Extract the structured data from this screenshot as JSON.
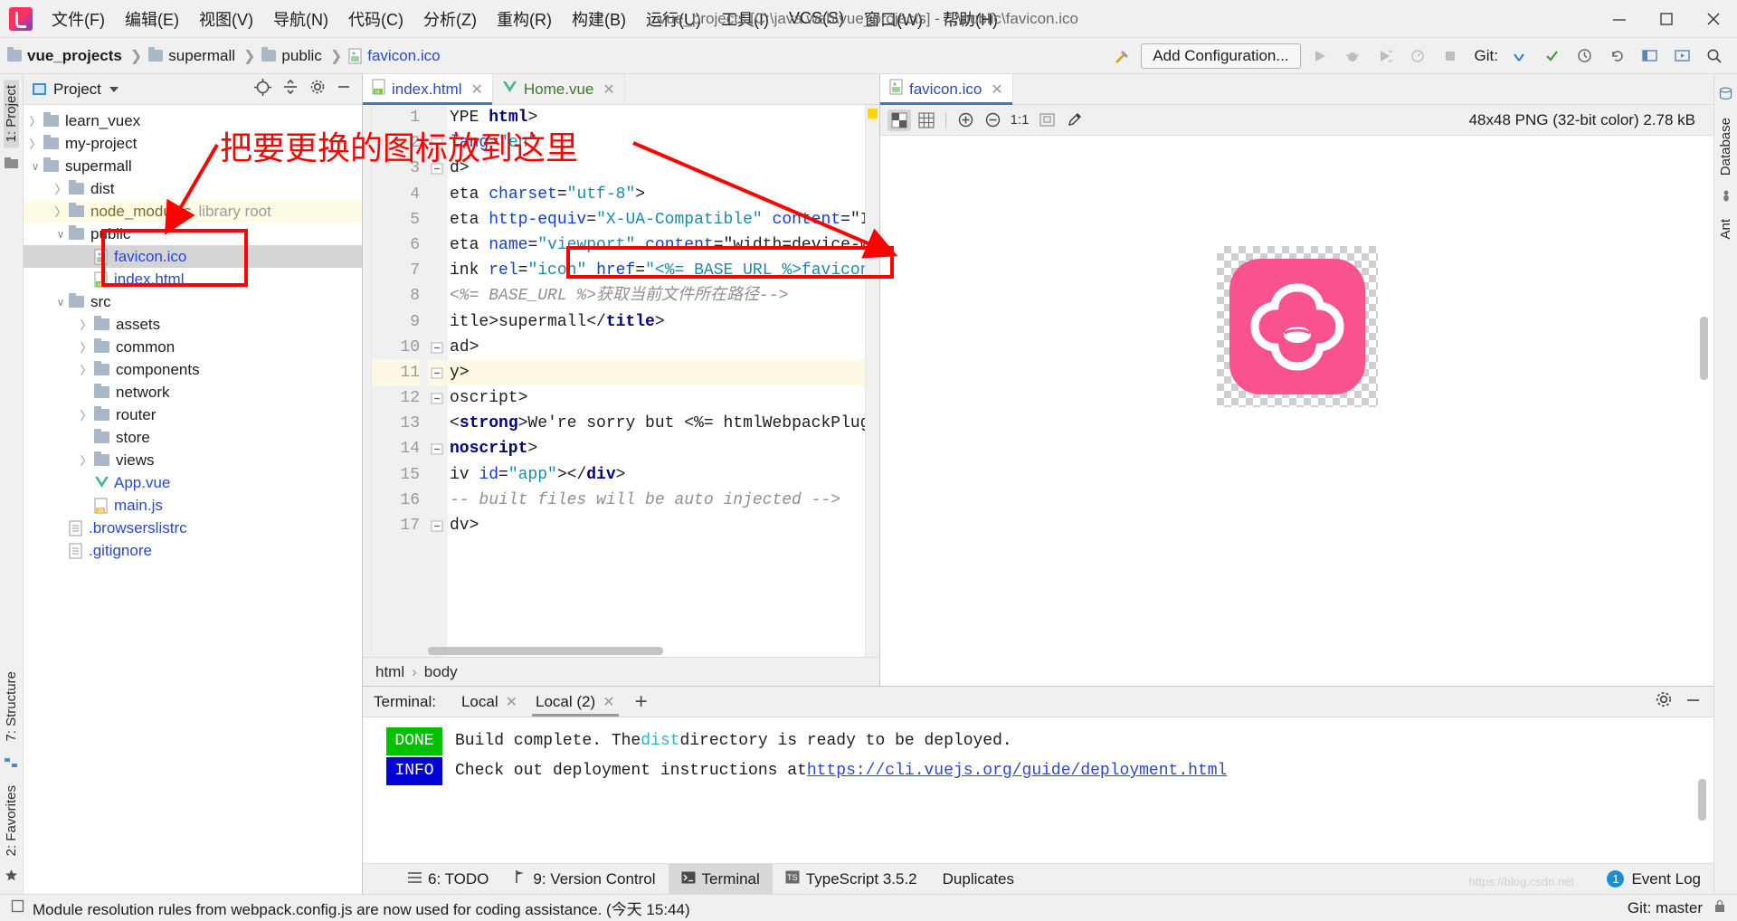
{
  "titlebar": {
    "logo_icon": "intellij-idea-logo",
    "menus": [
      "文件(F)",
      "编辑(E)",
      "视图(V)",
      "导航(N)",
      "代码(C)",
      "分析(Z)",
      "重构(R)",
      "构建(B)",
      "运行(U)",
      "工具(I)",
      "VCS(S)",
      "窗口(W)",
      "帮助(H)"
    ],
    "window_title": "vue_projects [C:\\java web\\vue_projects] - ...\\public\\favicon.ico",
    "minimize": "minimize-icon",
    "maximize": "maximize-icon",
    "close": "close-icon"
  },
  "navbar": {
    "breadcrumbs": [
      "vue_projects",
      "supermall",
      "public",
      "favicon.ico"
    ],
    "add_configuration": "Add Configuration...",
    "git_label": "Git:"
  },
  "left_strip": {
    "project_tab": "1: Project",
    "structure_tab": "7: Structure",
    "favorites_tab": "2: Favorites"
  },
  "right_strip": {
    "database_tab": "Database",
    "ant_tab": "Ant"
  },
  "project_panel": {
    "title": "Project",
    "tree": [
      {
        "label": "learn_vuex",
        "indent": 1,
        "arrow": "closed",
        "type": "folder"
      },
      {
        "label": "my-project",
        "indent": 1,
        "arrow": "closed",
        "type": "folder"
      },
      {
        "label": "supermall",
        "indent": 1,
        "arrow": "open",
        "type": "folder"
      },
      {
        "label": "dist",
        "indent": 2,
        "arrow": "closed",
        "type": "folder"
      },
      {
        "label": "node_modules",
        "indent": 2,
        "arrow": "closed",
        "type": "folder",
        "tag": "library root",
        "highlight": "library"
      },
      {
        "label": "public",
        "indent": 2,
        "arrow": "open",
        "type": "folder"
      },
      {
        "label": "favicon.ico",
        "indent": 3,
        "arrow": "none",
        "type": "image-file",
        "selected": true
      },
      {
        "label": "index.html",
        "indent": 3,
        "arrow": "none",
        "type": "html-file"
      },
      {
        "label": "src",
        "indent": 2,
        "arrow": "open",
        "type": "folder"
      },
      {
        "label": "assets",
        "indent": 3,
        "arrow": "closed",
        "type": "folder"
      },
      {
        "label": "common",
        "indent": 3,
        "arrow": "closed",
        "type": "folder"
      },
      {
        "label": "components",
        "indent": 3,
        "arrow": "closed",
        "type": "folder"
      },
      {
        "label": "network",
        "indent": 3,
        "arrow": "none",
        "type": "folder"
      },
      {
        "label": "router",
        "indent": 3,
        "arrow": "closed",
        "type": "folder"
      },
      {
        "label": "store",
        "indent": 3,
        "arrow": "none",
        "type": "folder"
      },
      {
        "label": "views",
        "indent": 3,
        "arrow": "closed",
        "type": "folder"
      },
      {
        "label": "App.vue",
        "indent": 3,
        "arrow": "none",
        "type": "vue-file"
      },
      {
        "label": "main.js",
        "indent": 3,
        "arrow": "none",
        "type": "js-file"
      },
      {
        "label": ".browserslistrc",
        "indent": 2,
        "arrow": "none",
        "type": "text-file"
      },
      {
        "label": ".gitignore",
        "indent": 2,
        "arrow": "none",
        "type": "text-file"
      }
    ]
  },
  "editor": {
    "tabs": [
      {
        "label": "index.html",
        "icon": "html-file-icon",
        "active": true
      },
      {
        "label": "Home.vue",
        "icon": "vue-file-icon",
        "active": false
      }
    ],
    "lines": [
      {
        "n": "1",
        "text": "YPE html>"
      },
      {
        "n": "2",
        "text": "lang=\"en\""
      },
      {
        "n": "3",
        "text": "d>"
      },
      {
        "n": "4",
        "text": "eta charset=\"utf-8\">"
      },
      {
        "n": "5",
        "text": "eta http-equiv=\"X-UA-Compatible\" content=\"IE=edge"
      },
      {
        "n": "6",
        "text": "eta name=\"viewport\" content=\"width=device-width, i"
      },
      {
        "n": "7",
        "text": "ink rel=\"icon\" href=\"<%= BASE_URL %>favicon.ico\">"
      },
      {
        "n": "8",
        "text": "<%= BASE_URL %>获取当前文件所在路径-->"
      },
      {
        "n": "9",
        "text": "itle>supermall</title>"
      },
      {
        "n": "10",
        "text": "ad>"
      },
      {
        "n": "11",
        "text": "y>",
        "highlighted": true
      },
      {
        "n": "12",
        "text": "oscript>"
      },
      {
        "n": "13",
        "text": "<strong>We're sorry but <%= htmlWebpackPlugin.options"
      },
      {
        "n": "14",
        "text": "noscript>"
      },
      {
        "n": "15",
        "text": "iv id=\"app\"></div>"
      },
      {
        "n": "16",
        "text": "-- built files will be auto injected -->"
      },
      {
        "n": "17",
        "text": "dv>"
      }
    ],
    "bottom_breadcrumbs": [
      "html",
      "body"
    ]
  },
  "image_viewer": {
    "tab_label": "favicon.ico",
    "toolbar_icons": [
      "transparency-grid-icon",
      "pixel-grid-icon",
      "zoom-in-icon",
      "zoom-out-icon",
      "actual-size-icon",
      "fit-to-window-icon",
      "color-picker-icon"
    ],
    "info": "48x48 PNG (32-bit color) 2.78 kB",
    "favicon_color": "#f9538f"
  },
  "terminal": {
    "label": "Terminal:",
    "tabs": [
      {
        "label": "Local",
        "active": false
      },
      {
        "label": "Local (2)",
        "active": true
      }
    ],
    "add_tab": "add-tab-icon",
    "lines": [
      {
        "badge": "DONE",
        "badge_color": "#00c000",
        "pre": "Build complete. The ",
        "code": "dist",
        "post": " directory is ready to be deployed."
      },
      {
        "badge": "INFO",
        "badge_color": "#0000d8",
        "pre": "Check out deployment instructions at ",
        "link": "https://cli.vuejs.org/guide/deployment.html",
        "post": ""
      }
    ]
  },
  "bottom_toolbar": {
    "items": [
      {
        "label": "6: TODO",
        "icon": "todo-icon",
        "active": false
      },
      {
        "label": "9: Version Control",
        "icon": "version-control-icon",
        "active": false
      },
      {
        "label": "Terminal",
        "icon": "terminal-icon",
        "active": true
      },
      {
        "label": "TypeScript 3.5.2",
        "icon": "typescript-icon",
        "active": false
      },
      {
        "label": "Duplicates",
        "icon": "",
        "active": false
      }
    ],
    "event_log": "Event Log",
    "event_count": "1"
  },
  "statusbar": {
    "message": "Module resolution rules from webpack.config.js are now used for coding assistance. (今天 15:44)",
    "git_branch": "Git: master"
  },
  "annotation": {
    "text": "把要更换的图标放到这里",
    "color": "#ff0000"
  }
}
